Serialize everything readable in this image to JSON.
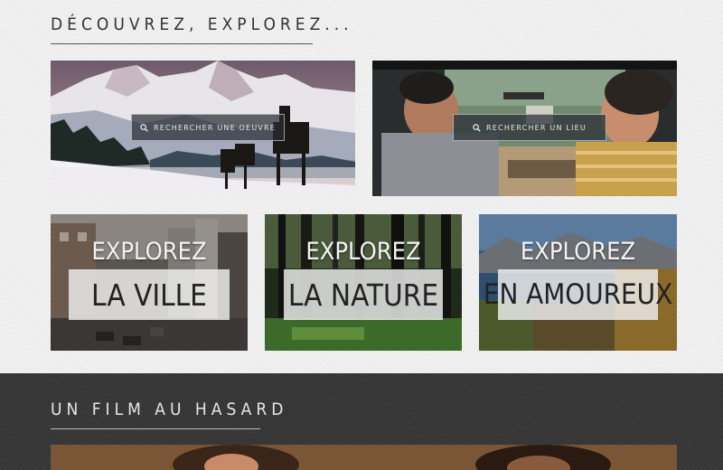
{
  "discover": {
    "title": "Découvrez, explorez...",
    "search_work_label": "Rechercher une oeuvre",
    "search_place_label": "Rechercher un lieu"
  },
  "explore": [
    {
      "top": "Explorez",
      "main": "La ville"
    },
    {
      "top": "Explorez",
      "main": "La nature"
    },
    {
      "top": "Explorez",
      "main": "En amoureux"
    }
  ],
  "random_film": {
    "title": "Un film au hasard"
  },
  "colors": {
    "light_bg": "#efefef",
    "dark_bg": "#383838",
    "title_dark": "#333333",
    "title_light": "#e6e6e6"
  },
  "icons": {
    "search": "search-icon"
  }
}
